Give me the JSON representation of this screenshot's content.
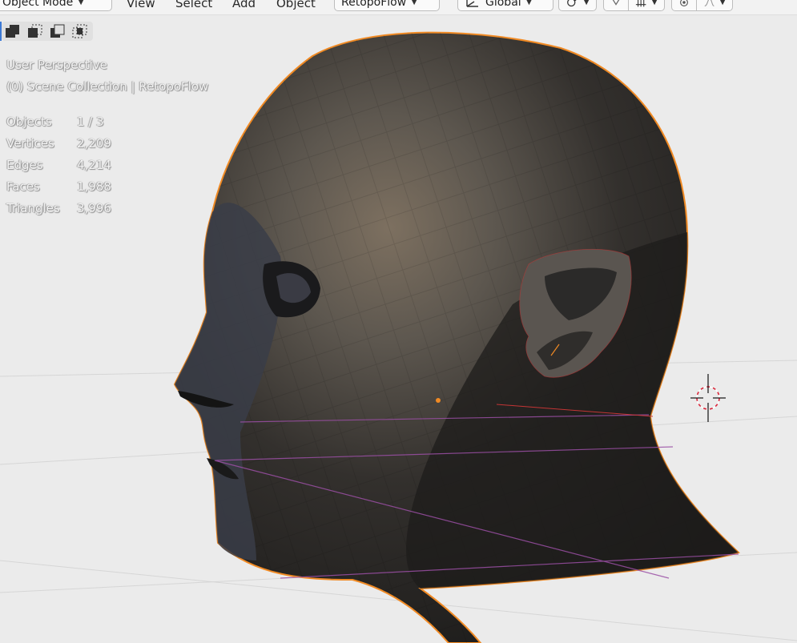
{
  "header": {
    "mode_label": "Object Mode",
    "menus": [
      "View",
      "Select",
      "Add",
      "Object"
    ],
    "workspace_label": "RetopoFlow",
    "orientation_label": "Global"
  },
  "overlay": {
    "view_name": "User Perspective",
    "collection": "(0) Scene Collection | RetopoFlow",
    "stats": [
      {
        "label": "Objects",
        "value": "1 / 3"
      },
      {
        "label": "Vertices",
        "value": "2,209"
      },
      {
        "label": "Edges",
        "value": "4,214"
      },
      {
        "label": "Faces",
        "value": "1,988"
      },
      {
        "label": "Triangles",
        "value": "3,996"
      }
    ]
  },
  "colors": {
    "selection_outline": "#f08a24",
    "cursor": "#d9263a",
    "guide_line": "#9b4fa5",
    "active_accent": "#3d7ad6"
  },
  "icons": {
    "selection_modes": [
      "select-new-icon",
      "select-extend-icon",
      "select-subtract-icon",
      "select-intersect-icon"
    ],
    "cursor": "3d-cursor-icon"
  }
}
